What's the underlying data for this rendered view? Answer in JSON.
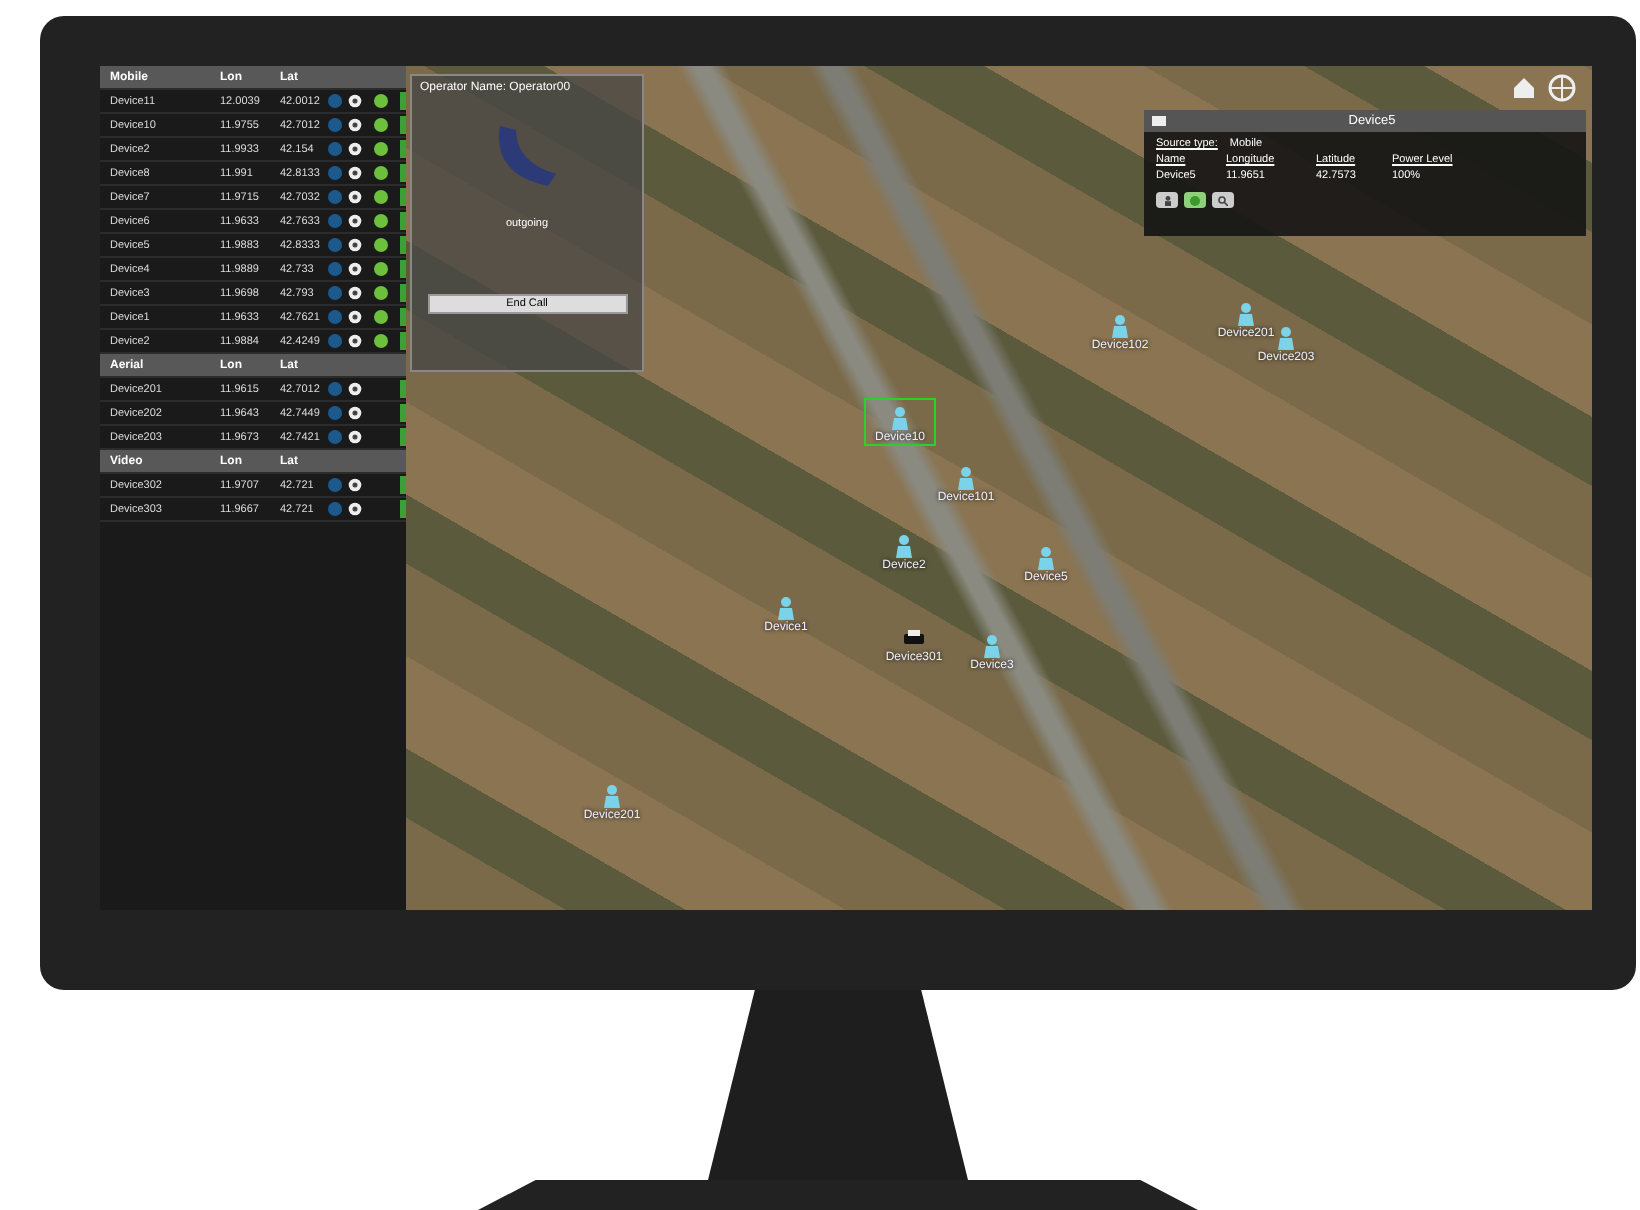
{
  "device_table": {
    "groups": [
      {
        "kind": "mobile",
        "title": "Mobile",
        "lon_label": "Lon",
        "lat_label": "Lat",
        "rows": [
          {
            "name": "Device11",
            "lon": "12.0039",
            "lat": "42.0012"
          },
          {
            "name": "Device10",
            "lon": "11.9755",
            "lat": "42.7012"
          },
          {
            "name": "Device2",
            "lon": "11.9933",
            "lat": "42.154"
          },
          {
            "name": "Device8",
            "lon": "11.991",
            "lat": "42.8133"
          },
          {
            "name": "Device7",
            "lon": "11.9715",
            "lat": "42.7032"
          },
          {
            "name": "Device6",
            "lon": "11.9633",
            "lat": "42.7633"
          },
          {
            "name": "Device5",
            "lon": "11.9883",
            "lat": "42.8333"
          },
          {
            "name": "Device4",
            "lon": "11.9889",
            "lat": "42.733"
          },
          {
            "name": "Device3",
            "lon": "11.9698",
            "lat": "42.793"
          },
          {
            "name": "Device1",
            "lon": "11.9633",
            "lat": "42.7621"
          },
          {
            "name": "Device2",
            "lon": "11.9884",
            "lat": "42.4249"
          }
        ]
      },
      {
        "kind": "aerial",
        "title": "Aerial",
        "lon_label": "Lon",
        "lat_label": "Lat",
        "rows": [
          {
            "name": "Device201",
            "lon": "11.9615",
            "lat": "42.7012"
          },
          {
            "name": "Device202",
            "lon": "11.9643",
            "lat": "42.7449"
          },
          {
            "name": "Device203",
            "lon": "11.9673",
            "lat": "42.7421"
          }
        ]
      },
      {
        "kind": "video",
        "title": "Video",
        "lon_label": "Lon",
        "lat_label": "Lat",
        "rows": [
          {
            "name": "Device302",
            "lon": "11.9707",
            "lat": "42.721"
          },
          {
            "name": "Device303",
            "lon": "11.9667",
            "lat": "42.721"
          }
        ]
      }
    ]
  },
  "call_panel": {
    "title": "Operator Name: Operator00",
    "status": "outgoing",
    "button": "End Call"
  },
  "device_popup": {
    "title": "Device5",
    "source_label": "Source type:",
    "source_value": "Mobile",
    "columns": [
      "Name",
      "Longitude",
      "Latitude",
      "Power Level"
    ],
    "values": [
      "Device5",
      "11.9651",
      "42.7573",
      "100%"
    ]
  },
  "map": {
    "markers": [
      {
        "label": "Device102",
        "kind": "person",
        "selected": false
      },
      {
        "label": "Device201",
        "kind": "person",
        "selected": false
      },
      {
        "label": "Device203",
        "kind": "person",
        "selected": false
      },
      {
        "label": "Device10",
        "kind": "person",
        "selected": true
      },
      {
        "label": "Device101",
        "kind": "person",
        "selected": false
      },
      {
        "label": "Device2",
        "kind": "person",
        "selected": false
      },
      {
        "label": "Device5",
        "kind": "person",
        "selected": false
      },
      {
        "label": "Device1",
        "kind": "person",
        "selected": false
      },
      {
        "label": "Device301",
        "kind": "car",
        "selected": false
      },
      {
        "label": "Device3",
        "kind": "person",
        "selected": false
      },
      {
        "label": "Device201",
        "kind": "person",
        "selected": false
      }
    ]
  }
}
